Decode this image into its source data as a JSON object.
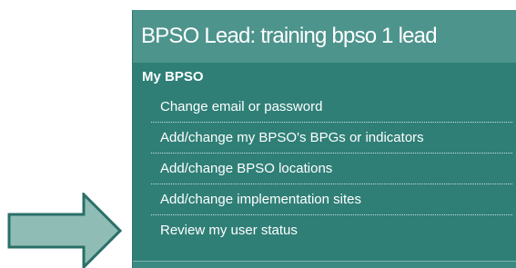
{
  "panel": {
    "title": "BPSO Lead: training bpso 1 lead",
    "section_title": "My BPSO",
    "items": [
      {
        "label": "Change email or password"
      },
      {
        "label": "Add/change my BPSO's BPGs or indicators"
      },
      {
        "label": "Add/change BPSO locations"
      },
      {
        "label": "Add/change implementation sites"
      },
      {
        "label": "Review my user status"
      }
    ]
  },
  "colors": {
    "panel_bg": "#2f7f77",
    "header_bg": "#4d948d",
    "arrow_fill": "#8fbdb6",
    "arrow_stroke": "#2a6f68"
  },
  "icons": {
    "arrow": "arrow-right-icon"
  }
}
